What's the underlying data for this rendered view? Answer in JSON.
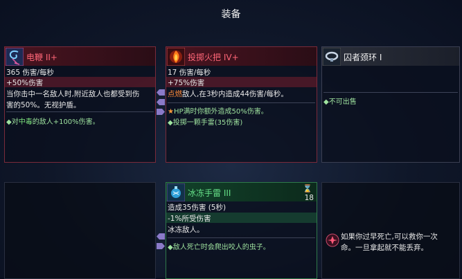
{
  "title": "装备",
  "cards": {
    "whip": {
      "name": "电鞭 II+",
      "stat1": "365 伤害/每秒",
      "stat2": "+50%伤害",
      "desc1": "当你击中一名敌人时,附近敌人也都受到伤",
      "desc2": "害的50%。无视护盾。",
      "syn_prefix": "◆对",
      "syn_highlight": "中毒",
      "syn_suffix": "的敌人+100%伤害。"
    },
    "torch": {
      "name": "投掷火把 IV+",
      "stat1": "17 伤害/每秒",
      "stat2": "+75%伤害",
      "desc_highlight": "点燃",
      "desc_rest": "敌人,在3秒内造成44伤害/每秒。",
      "syn1": "HP满时你额外造成50%伤害。",
      "syn2": "◆投掷一颗手雷(35伤害)"
    },
    "collar": {
      "name": "囚者颈环 I",
      "syn1": "◆不可出售"
    },
    "grenade": {
      "name": "冰冻手雷 III",
      "stat1": "造成35伤害 (5秒)",
      "stat2": "-1%所受伤害",
      "desc1": "冰冻敌人。",
      "syn1": "◆敌人死亡时会爬出咬人的虫子。",
      "counter": "18"
    },
    "tooltip": {
      "line1": "如果你过早死亡,可以救你一次",
      "line2": "命。一旦拿起就不能丢弃。"
    }
  },
  "colors": {
    "poison": "#7de27d",
    "ignite": "#ff8a3a",
    "star": "#ff9a3a"
  }
}
